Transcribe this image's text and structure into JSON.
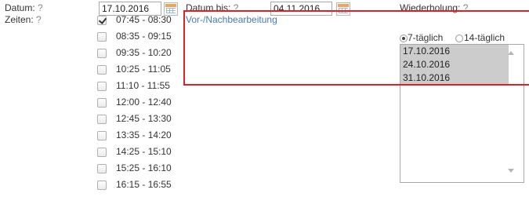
{
  "form": {
    "datum_label": "Datum:",
    "datum_help": "?",
    "datum_value": "17.10.2016",
    "zeiten_label": "Zeiten:",
    "zeiten_help": "?",
    "datum_bis_label": "Datum bis:",
    "datum_bis_help": "?",
    "datum_bis_value": "04.11.2016",
    "vor_nach_link": "Vor-/Nachbearbeitung",
    "wiederholung_label": "Wiederholung:",
    "wiederholung_help": "?",
    "option_7": "7-täglich",
    "option_14": "14-täglich",
    "selected_option": "7-täglich"
  },
  "times": [
    {
      "label": "07:45 - 08:30",
      "checked": true
    },
    {
      "label": "08:35 - 09:15",
      "checked": false
    },
    {
      "label": "09:35 - 10:20",
      "checked": false
    },
    {
      "label": "10:25 - 11:05",
      "checked": false
    },
    {
      "label": "11:10 - 11:55",
      "checked": false
    },
    {
      "label": "12:00 - 12:40",
      "checked": false
    },
    {
      "label": "12:45 - 13:30",
      "checked": false
    },
    {
      "label": "13:35 - 14:20",
      "checked": false
    },
    {
      "label": "14:25 - 15:10",
      "checked": false
    },
    {
      "label": "15:25 - 16:10",
      "checked": false
    },
    {
      "label": "16:15 - 16:55",
      "checked": false
    }
  ],
  "dates_list": [
    "17.10.2016",
    "24.10.2016",
    "31.10.2016"
  ],
  "icons": {
    "calendar": "calendar-icon",
    "scroll_up": "scroll-up-arrow-icon",
    "scroll_down": "scroll-down-arrow-icon"
  },
  "colors": {
    "highlight_border": "#d9232a",
    "link": "#4a78b0",
    "list_selection": "#cccccc"
  }
}
